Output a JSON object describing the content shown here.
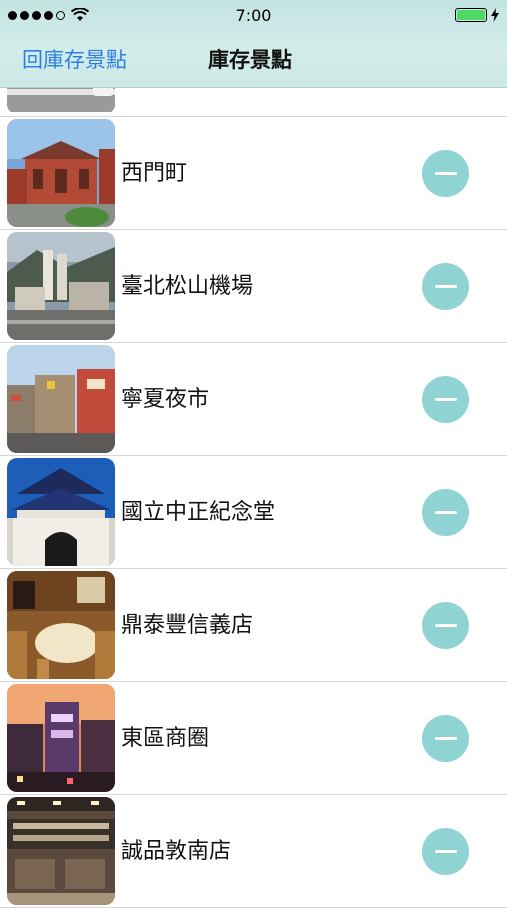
{
  "status_bar": {
    "time": "7:00"
  },
  "nav": {
    "back_label": "回庫存景點",
    "title": "庫存景點"
  },
  "items": [
    {
      "label": "西門町",
      "image": "red-brick-building-photo"
    },
    {
      "label": "臺北松山機場",
      "image": "city-skyline-photo"
    },
    {
      "label": "寧夏夜市",
      "image": "street-market-photo"
    },
    {
      "label": "國立中正紀念堂",
      "image": "memorial-gate-photo"
    },
    {
      "label": "鼎泰豐信義店",
      "image": "restaurant-interior-photo"
    },
    {
      "label": "東區商圈",
      "image": "night-shopping-district-photo"
    },
    {
      "label": "誠品敦南店",
      "image": "bookstore-interior-photo"
    }
  ],
  "colors": {
    "accent": "#2d7fdf",
    "remove_button": "#8fd3d3",
    "nav_bg": "#cfe9e7"
  }
}
